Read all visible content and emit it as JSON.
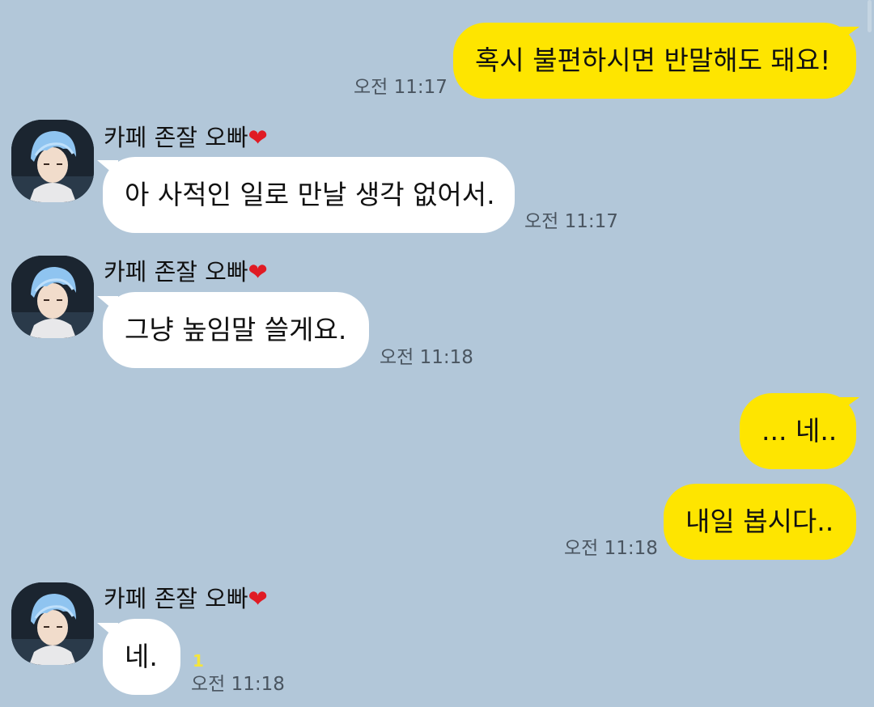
{
  "messages": [
    {
      "dir": "out",
      "text": "혹시 불편하시면 반말해도 돼요!",
      "time": "오전 11:17"
    },
    {
      "dir": "in",
      "sender": "카페 존잘 오빠",
      "text": "아 사적인 일로 만날 생각 없어서.",
      "time": "오전 11:17"
    },
    {
      "dir": "in",
      "sender": "카페 존잘 오빠",
      "text": "그냥 높임말 쓸게요.",
      "time": "오전 11:18"
    },
    {
      "dir": "out",
      "text": "... 네..",
      "time": ""
    },
    {
      "dir": "out",
      "text": "내일 봅시다..",
      "time": "오전 11:18"
    },
    {
      "dir": "in",
      "sender": "카페 존잘 오빠",
      "text": "네.",
      "time": "오전 11:18",
      "unread": "1"
    }
  ],
  "heart_glyph": "❤",
  "colors": {
    "background": "#b2c7d9",
    "outgoing_bubble": "#fee500",
    "incoming_bubble": "#ffffff",
    "unread": "#f5e53a",
    "heart": "#e01b24"
  },
  "icons": {
    "avatar": "profile-photo-blue-hair"
  }
}
